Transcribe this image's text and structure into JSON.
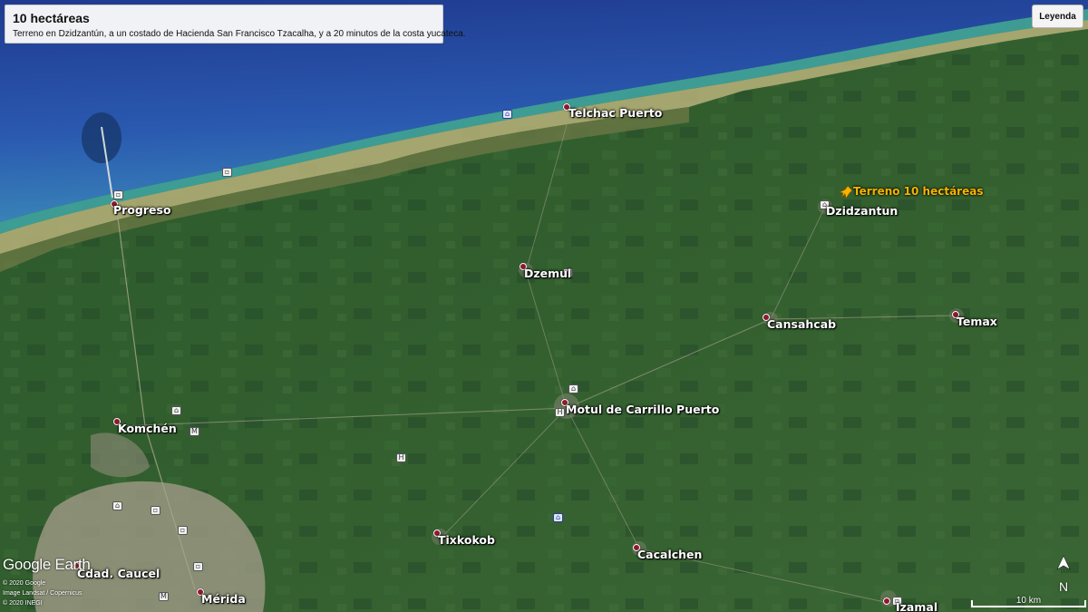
{
  "info": {
    "title": "10 hectáreas",
    "description": "Terreno en Dzidzantún, a un costado de Hacienda San Francisco Tzacalha, y a 20 minutos de la costa yucateca."
  },
  "legend_button": "Leyenda",
  "places": [
    {
      "name": "Telchac Puerto"
    },
    {
      "name": "Progreso"
    },
    {
      "name": "Dzidzantun"
    },
    {
      "name": "Dzemul"
    },
    {
      "name": "Cansahcab"
    },
    {
      "name": "Temax"
    },
    {
      "name": "Motul de Carrillo Puerto"
    },
    {
      "name": "Komchén"
    },
    {
      "name": "Tixkokob"
    },
    {
      "name": "Cacalchen"
    },
    {
      "name": "Cdad. Caucel"
    },
    {
      "name": "Mérida"
    },
    {
      "name": "Izamal"
    }
  ],
  "pin": {
    "label": "Terreno 10 hectáreas",
    "color": "#f5b400",
    "icon": "pushpin-icon"
  },
  "attribution": {
    "logo": "Google Earth",
    "lines": [
      "© 2020 Google",
      "Image Landsat / Copernicus",
      "© 2020 INEGI"
    ]
  },
  "north_arrow": {
    "label": "N"
  },
  "scale_bar": {
    "label": "10 km"
  },
  "colors": {
    "sea_deep": "#233f96",
    "sea_shallow": "#3fa0a8",
    "land": "#2f5a2c",
    "place_dot": "#8e1a2b"
  }
}
